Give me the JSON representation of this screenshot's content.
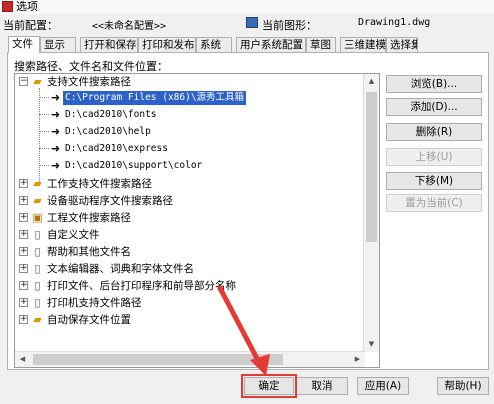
{
  "window": {
    "title": "选项"
  },
  "info": {
    "current_profile_label": "当前配置：",
    "current_profile_value": "<<未命名配置>>",
    "current_drawing_label": "当前图形：",
    "current_drawing_value": "Drawing1.dwg"
  },
  "tabs": [
    "文件",
    "显示",
    "打开和保存",
    "打印和发布",
    "系统",
    "用户系统配置",
    "草图",
    "三维建模",
    "选择集"
  ],
  "active_tab": "文件",
  "panel": {
    "section_label": "搜索路径、文件名和文件位置：",
    "tree": {
      "items": [
        {
          "label": "支持文件搜索路径",
          "expanded": true,
          "icon": "folder-icon"
        },
        {
          "label": "C:\\Program Files (x86)\\源秀工具箱",
          "child": true,
          "selected": true
        },
        {
          "label": "D:\\cad2010\\fonts",
          "child": true
        },
        {
          "label": "D:\\cad2010\\help",
          "child": true
        },
        {
          "label": "D:\\cad2010\\express",
          "child": true
        },
        {
          "label": "D:\\cad2010\\support\\color",
          "child": true
        },
        {
          "label": "工作支持文件搜索路径",
          "icon": "folder-icon"
        },
        {
          "label": "设备驱动程序文件搜索路径",
          "icon": "folder-icon"
        },
        {
          "label": "工程文件搜索路径",
          "icon": "project-icon"
        },
        {
          "label": "自定义文件",
          "icon": "document-icon"
        },
        {
          "label": "帮助和其他文件名",
          "icon": "document-icon"
        },
        {
          "label": "文本编辑器、词典和字体文件名",
          "icon": "document-icon"
        },
        {
          "label": "打印文件、后台打印程序和前导部分名称",
          "icon": "document-icon"
        },
        {
          "label": "打印机支持文件路径",
          "icon": "document-icon"
        },
        {
          "label": "自动保存文件位置",
          "icon": "folder-icon"
        }
      ]
    }
  },
  "side_buttons": {
    "browse": "浏览(B)...",
    "add": "添加(D)...",
    "remove": "删除(R)",
    "move_up": "上移(U)",
    "move_down": "下移(M)",
    "set_current": "置为当前(C)"
  },
  "footer": {
    "ok": "确定",
    "cancel": "取消",
    "apply": "应用(A)",
    "help": "帮助(H)"
  },
  "colors": {
    "selection": "#2a62c9",
    "annotation": "#e53935"
  }
}
